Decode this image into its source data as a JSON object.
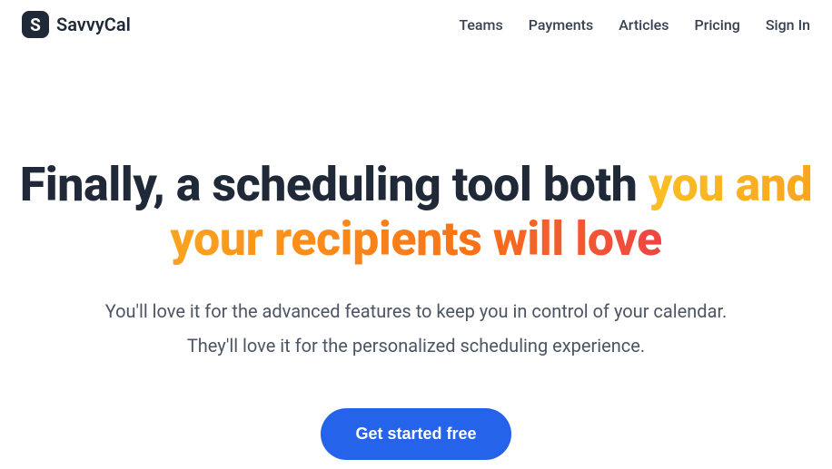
{
  "brand": {
    "name": "SavvyCal",
    "logo_glyph": "S"
  },
  "nav": {
    "items": [
      {
        "label": "Teams"
      },
      {
        "label": "Payments"
      },
      {
        "label": "Articles"
      },
      {
        "label": "Pricing"
      },
      {
        "label": "Sign In"
      }
    ]
  },
  "hero": {
    "title_plain": "Finally, a scheduling tool both ",
    "title_accent": "you and your recipients will love",
    "sub_line1": "You'll love it for the advanced features to keep you in control of your calendar.",
    "sub_line2": "They'll love it for the personalized scheduling experience.",
    "cta_label": "Get started free"
  },
  "colors": {
    "brand_dark": "#1f2937",
    "cta_blue": "#2563eb",
    "gradient_start": "#fbbf24",
    "gradient_mid": "#f97316",
    "gradient_end": "#ef4444"
  }
}
